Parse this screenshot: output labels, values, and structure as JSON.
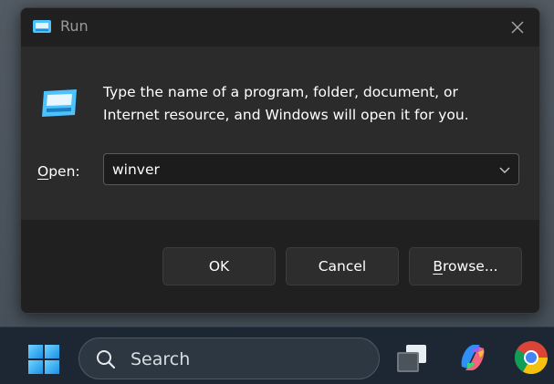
{
  "window": {
    "title": "Run",
    "close_label": "✕"
  },
  "dialog": {
    "description": "Type the name of a program, folder, document, or Internet resource, and Windows will open it for you.",
    "open_label_accel": "O",
    "open_label_rest": "pen:",
    "open_value": "winver"
  },
  "buttons": {
    "ok": "OK",
    "cancel": "Cancel",
    "browse_accel": "B",
    "browse_rest": "rowse..."
  },
  "taskbar": {
    "search_placeholder": "Search",
    "apps": [
      "windows-start-icon",
      "task-view-icon",
      "copilot-icon",
      "chrome-icon"
    ]
  },
  "colors": {
    "dialog_bg": "#202020",
    "body_bg": "#2b2b2b",
    "accent_cyan": "#4cc2ff",
    "taskbar_bg": "#1d2733"
  }
}
